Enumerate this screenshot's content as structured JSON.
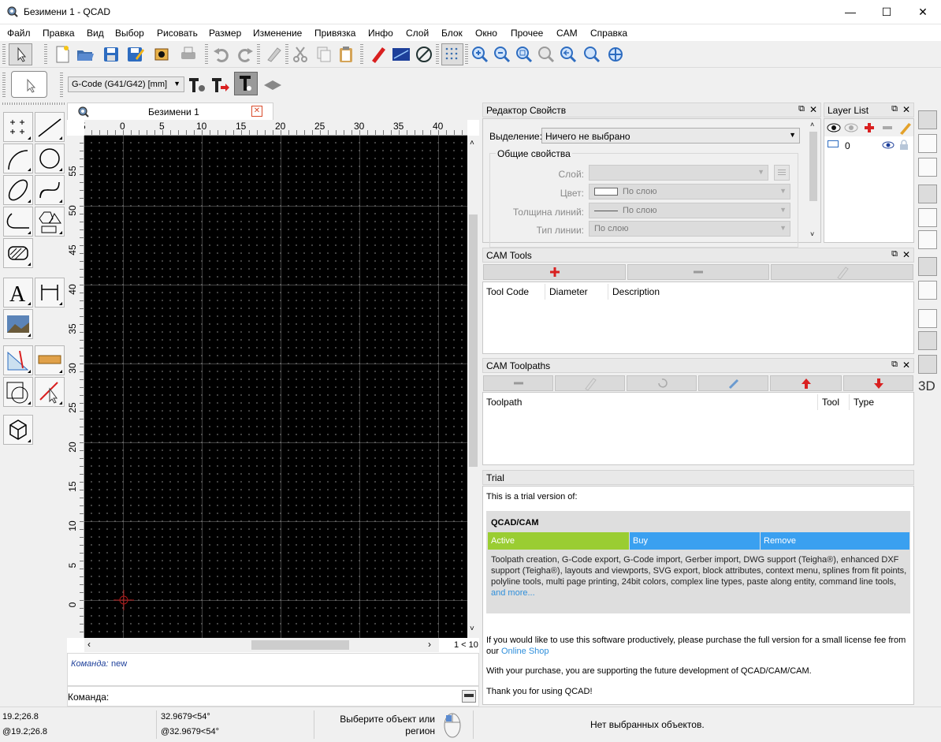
{
  "window": {
    "title": "Безимени 1 - QCAD",
    "controls": [
      "—",
      "☐",
      "✕"
    ]
  },
  "menu": [
    "Файл",
    "Правка",
    "Вид",
    "Выбор",
    "Рисовать",
    "Размер",
    "Изменение",
    "Привязка",
    "Инфо",
    "Слой",
    "Блок",
    "Окно",
    "Прочее",
    "CAM",
    "Справка"
  ],
  "toolbar2": {
    "gcode_select": "G-Code (G41/G42) [mm]"
  },
  "document": {
    "tab_title": "Безимени 1",
    "hruler_labels": [
      "5",
      "0",
      "5",
      "10",
      "15",
      "20",
      "25",
      "30",
      "35",
      "40"
    ],
    "vruler_labels": [
      "55",
      "50",
      "45",
      "40",
      "35",
      "30",
      "25",
      "20",
      "15",
      "10",
      "5",
      "0",
      "5"
    ],
    "page_indicator": "1 < 10"
  },
  "command": {
    "history_label": "Команда:",
    "history_value": "new",
    "prompt": "Команда:"
  },
  "property_editor": {
    "title": "Редактор Свойств",
    "selection_label": "Выделение:",
    "selection_value": "Ничего не выбрано",
    "group_title": "Общие свойства",
    "rows": [
      {
        "label": "Слой:",
        "value": ""
      },
      {
        "label": "Цвет:",
        "value": "По слою"
      },
      {
        "label": "Толщина линий:",
        "value": "По слою"
      },
      {
        "label": "Тип линии:",
        "value": "По слою"
      }
    ]
  },
  "layer_list": {
    "title": "Layer List",
    "layers": [
      {
        "name": "0",
        "color": "#ffffff"
      }
    ]
  },
  "cam_tools": {
    "title": "CAM Tools",
    "columns": [
      "Tool Code",
      "Diameter",
      "Description"
    ]
  },
  "cam_toolpaths": {
    "title": "CAM Toolpaths",
    "columns": [
      "Toolpath",
      "Tool",
      "Type"
    ]
  },
  "trial": {
    "title": "Trial",
    "intro": "This is a trial version of:",
    "product": "QCAD/CAM",
    "buttons": [
      "Active",
      "Buy",
      "Remove"
    ],
    "features": "Toolpath creation, G-Code export, G-Code import, Gerber import, DWG support (Teigha®), enhanced DXF support (Teigha®), layouts and viewports, SVG export, block attributes, context menu, splines from fit points, polyline tools, multi page printing, 24bit colors, complex line types, paste along entity, command line tools,",
    "more_link": "and more...",
    "purchase_text": "If you would like to use this software productively, please purchase the full version for a small license fee from our",
    "shop_link": "Online Shop",
    "support_text": "With your purchase, you are supporting the future development of QCAD/CAM/CAM.",
    "thanks_text": "Thank you for using QCAD!"
  },
  "right_sidebar": {
    "label_3d": "3D"
  },
  "status": {
    "coord_abs": "19.2;26.8",
    "coord_rel": "@19.2;26.8",
    "polar_abs": "32.9679<54°",
    "polar_rel": "@32.9679<54°",
    "hint": "Выберите объект или регион",
    "selection": "Нет выбранных объектов."
  },
  "colors": {
    "active": "#9acd32",
    "buy": "#3aa0f0",
    "remove": "#3aa0f0",
    "accent": "#0078d7",
    "link": "#2f8fdb"
  }
}
